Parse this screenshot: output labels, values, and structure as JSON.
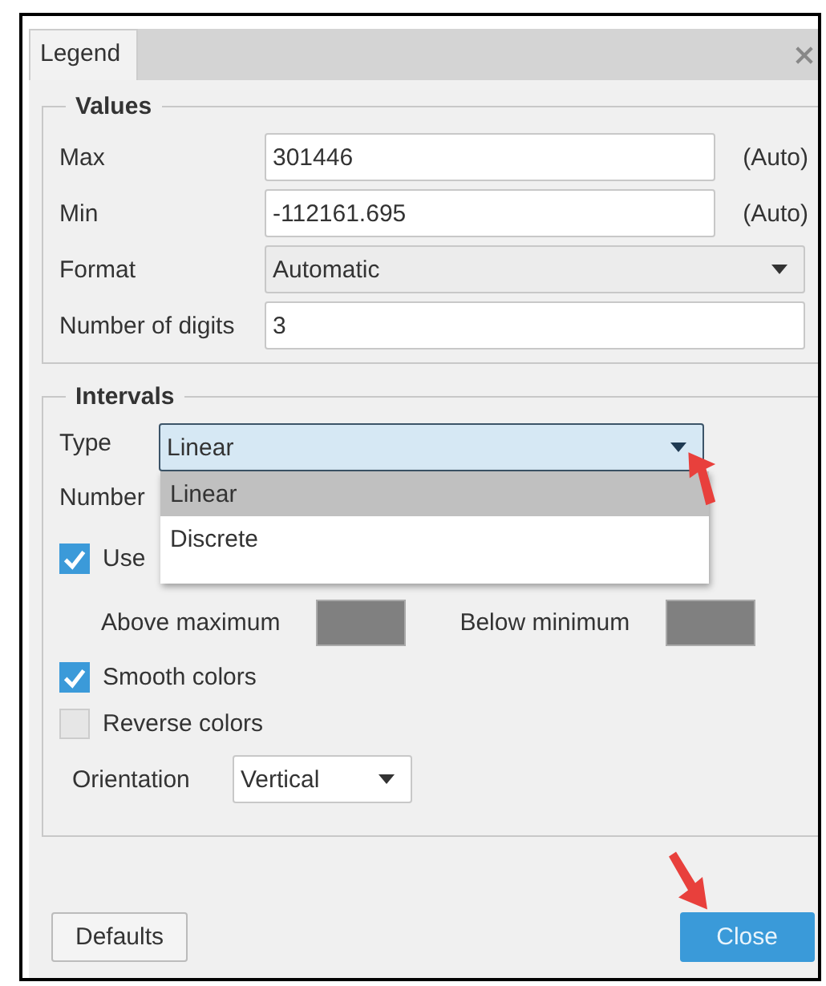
{
  "tab": {
    "label": "Legend",
    "selected": true
  },
  "values": {
    "title": "Values",
    "rows": [
      {
        "kind": "input",
        "label": "Max",
        "value": "301446",
        "suffix": "(Auto)"
      },
      {
        "kind": "input",
        "label": "Min",
        "value": "-112161.695",
        "suffix": "(Auto)"
      },
      {
        "kind": "select",
        "label": "Format",
        "value": "Automatic"
      },
      {
        "kind": "input",
        "label": "Number of digits",
        "value": "3"
      }
    ]
  },
  "intervals": {
    "title": "Intervals",
    "type": {
      "label": "Type",
      "value": "Linear",
      "open": true,
      "options": [
        {
          "label": "Linear",
          "selected": true
        },
        {
          "label": "Discrete",
          "selected": false
        }
      ]
    },
    "number_label": "Number",
    "use": {
      "label": "Use",
      "checked": true
    },
    "above": {
      "label": "Above maximum"
    },
    "below": {
      "label": "Below minimum"
    },
    "checkboxes": [
      {
        "label": "Smooth colors",
        "checked": true
      },
      {
        "label": "Reverse colors",
        "checked": false
      }
    ],
    "orientation": {
      "label": "Orientation",
      "value": "Vertical"
    }
  },
  "buttons": [
    {
      "kind": "default",
      "label": "Defaults"
    },
    {
      "kind": "primary",
      "label": "Close"
    }
  ]
}
